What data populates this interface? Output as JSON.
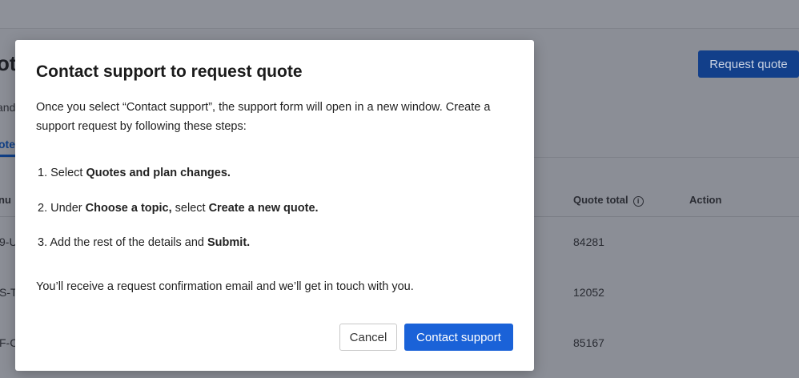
{
  "background": {
    "title_fragment": "ot",
    "subtitle_fragment": "and",
    "tab_fragment": "ote",
    "request_quote_label": "Request quote",
    "table": {
      "headers": {
        "number_fragment": "nu",
        "quote_total": "Quote total",
        "action": "Action"
      },
      "rows": [
        {
          "id_fragment": "9-U",
          "total": "84281"
        },
        {
          "id_fragment": "S-T",
          "total": "12052"
        },
        {
          "id_fragment": "F-C",
          "total": "85167"
        }
      ]
    }
  },
  "modal": {
    "title": "Contact support to request quote",
    "intro": "Once you select “Contact support”, the support form will open in a new window. Create a support request by following these steps:",
    "steps": [
      {
        "num": "1.",
        "pre": "Select ",
        "b1": "Quotes and plan changes.",
        "mid": "",
        "b2": ""
      },
      {
        "num": "2.",
        "pre": "Under ",
        "b1": "Choose a topic,",
        "mid": " select ",
        "b2": "Create a new quote."
      },
      {
        "num": "3.",
        "pre": "Add the rest of the details and ",
        "b1": "Submit.",
        "mid": "",
        "b2": ""
      }
    ],
    "confirmation": "You’ll receive a request confirmation email and we’ll get in touch with you.",
    "cancel_label": "Cancel",
    "contact_label": "Contact support"
  },
  "colors": {
    "accent": "#1a62d8"
  }
}
